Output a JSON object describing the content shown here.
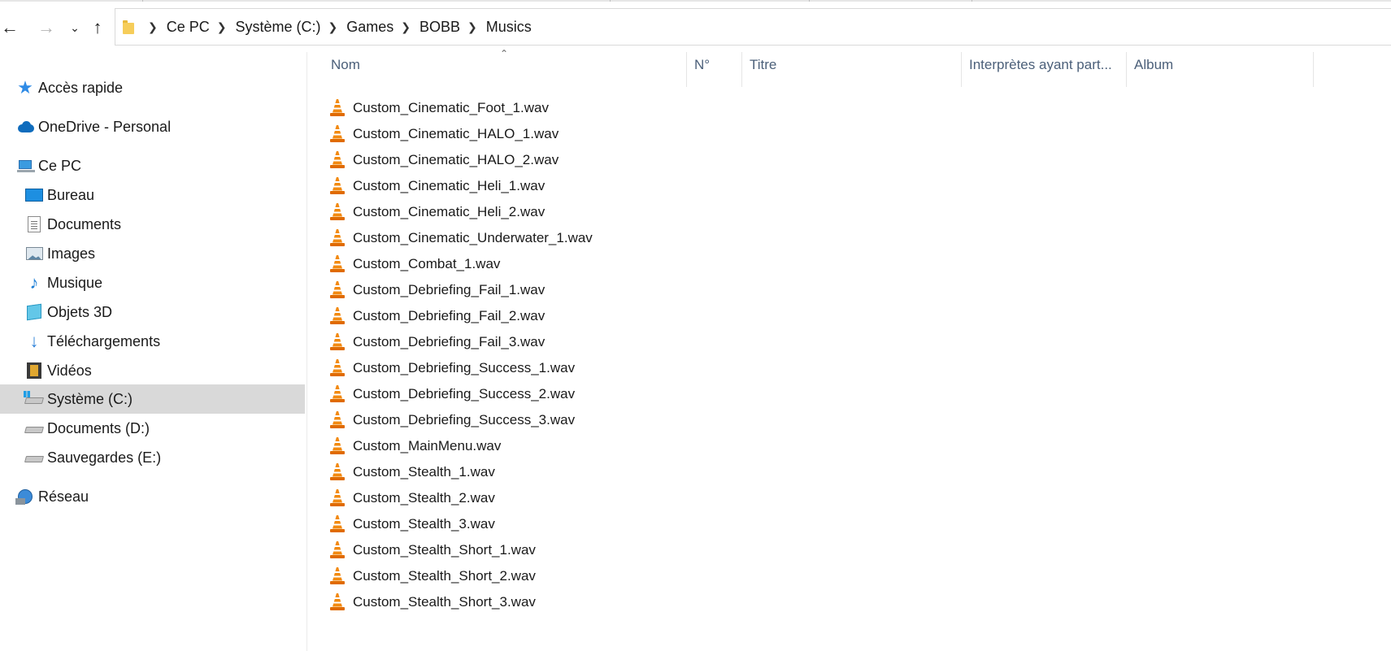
{
  "window": {
    "title": "Musics"
  },
  "address_bar": {
    "breadcrumbs": [
      "Ce PC",
      "Système (C:)",
      "Games",
      "BOBB",
      "Musics"
    ]
  },
  "sidebar": {
    "items": [
      {
        "label": "Accès rapide",
        "icon": "star-icon"
      },
      {
        "label": "OneDrive - Personal",
        "icon": "cloud-icon"
      },
      {
        "label": "Ce PC",
        "icon": "computer-icon"
      },
      {
        "label": "Bureau",
        "icon": "desktop-icon"
      },
      {
        "label": "Documents",
        "icon": "document-icon"
      },
      {
        "label": "Images",
        "icon": "picture-icon"
      },
      {
        "label": "Musique",
        "icon": "music-note-icon"
      },
      {
        "label": "Objets 3D",
        "icon": "cube-icon"
      },
      {
        "label": "Téléchargements",
        "icon": "download-arrow-icon"
      },
      {
        "label": "Vidéos",
        "icon": "film-icon"
      },
      {
        "label": "Système (C:)",
        "icon": "windows-drive-icon"
      },
      {
        "label": "Documents (D:)",
        "icon": "drive-icon"
      },
      {
        "label": "Sauvegardes (E:)",
        "icon": "drive-icon"
      },
      {
        "label": "Réseau",
        "icon": "network-icon"
      }
    ],
    "selected": "Système (C:)"
  },
  "columns": [
    {
      "label": "Nom"
    },
    {
      "label": "N°"
    },
    {
      "label": "Titre"
    },
    {
      "label": "Interprètes ayant part..."
    },
    {
      "label": "Album"
    }
  ],
  "files": [
    {
      "name": "Custom_Cinematic_Foot_1.wav",
      "icon": "vlc-cone-icon"
    },
    {
      "name": "Custom_Cinematic_HALO_1.wav",
      "icon": "vlc-cone-icon"
    },
    {
      "name": "Custom_Cinematic_HALO_2.wav",
      "icon": "vlc-cone-icon"
    },
    {
      "name": "Custom_Cinematic_Heli_1.wav",
      "icon": "vlc-cone-icon"
    },
    {
      "name": "Custom_Cinematic_Heli_2.wav",
      "icon": "vlc-cone-icon"
    },
    {
      "name": "Custom_Cinematic_Underwater_1.wav",
      "icon": "vlc-cone-icon"
    },
    {
      "name": "Custom_Combat_1.wav",
      "icon": "vlc-cone-icon"
    },
    {
      "name": "Custom_Debriefing_Fail_1.wav",
      "icon": "vlc-cone-icon"
    },
    {
      "name": "Custom_Debriefing_Fail_2.wav",
      "icon": "vlc-cone-icon"
    },
    {
      "name": "Custom_Debriefing_Fail_3.wav",
      "icon": "vlc-cone-icon"
    },
    {
      "name": "Custom_Debriefing_Success_1.wav",
      "icon": "vlc-cone-icon"
    },
    {
      "name": "Custom_Debriefing_Success_2.wav",
      "icon": "vlc-cone-icon"
    },
    {
      "name": "Custom_Debriefing_Success_3.wav",
      "icon": "vlc-cone-icon"
    },
    {
      "name": "Custom_MainMenu.wav",
      "icon": "vlc-cone-icon"
    },
    {
      "name": "Custom_Stealth_1.wav",
      "icon": "vlc-cone-icon"
    },
    {
      "name": "Custom_Stealth_2.wav",
      "icon": "vlc-cone-icon"
    },
    {
      "name": "Custom_Stealth_3.wav",
      "icon": "vlc-cone-icon"
    },
    {
      "name": "Custom_Stealth_Short_1.wav",
      "icon": "vlc-cone-icon"
    },
    {
      "name": "Custom_Stealth_Short_2.wav",
      "icon": "vlc-cone-icon"
    },
    {
      "name": "Custom_Stealth_Short_3.wav",
      "icon": "vlc-cone-icon"
    }
  ],
  "colors": {
    "selection": "#d9d9d9",
    "header_text": "#4c607a",
    "accent": "#0f6cbd"
  }
}
